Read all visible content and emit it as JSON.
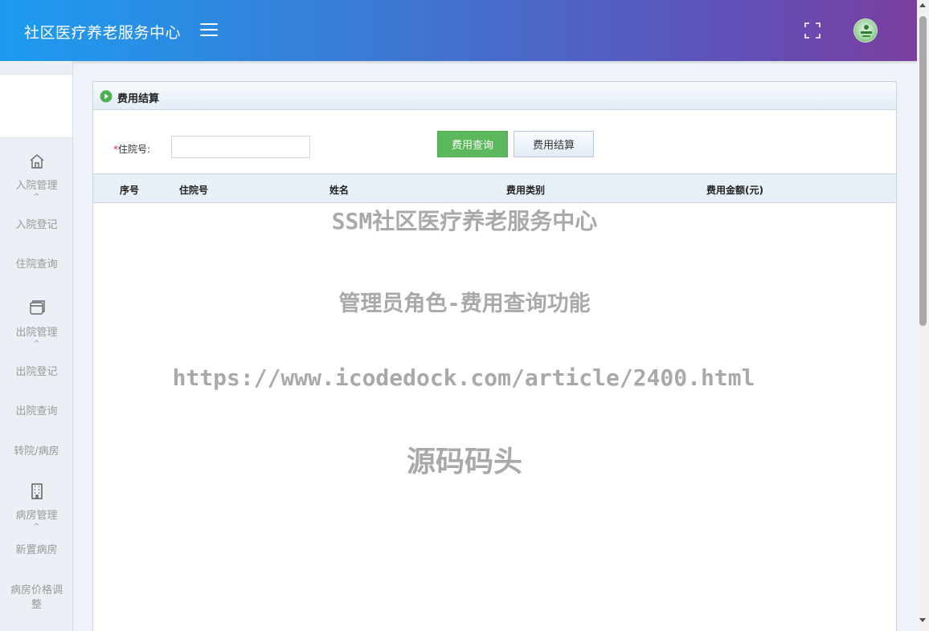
{
  "header": {
    "title": "社区医疗养老服务中心",
    "menu_icon": "hamburger-icon",
    "fullscreen_icon": "fullscreen-icon",
    "avatar_icon": "user-avatar"
  },
  "sidebar": {
    "groups": [
      {
        "label": "入院管理",
        "icon": "home-icon",
        "caret": "^",
        "items": [
          {
            "label": "入院登记"
          },
          {
            "label": "住院查询"
          }
        ]
      },
      {
        "label": "出院管理",
        "icon": "window-icon",
        "caret": "^",
        "items": [
          {
            "label": "出院登记"
          },
          {
            "label": "出院查询"
          },
          {
            "label": "转院/病房"
          }
        ]
      },
      {
        "label": "病房管理",
        "icon": "building-icon",
        "caret": "^",
        "items": [
          {
            "label": "新置病房"
          },
          {
            "label": "病房价格调整"
          }
        ]
      }
    ]
  },
  "panel": {
    "title": "费用结算",
    "form": {
      "required_mark": "*",
      "label": "住院号:",
      "input_value": "",
      "query_button": "费用查询",
      "settle_button": "费用结算"
    },
    "table": {
      "columns": [
        "序号",
        "住院号",
        "姓名",
        "费用类别",
        "费用金额(元)"
      ],
      "rows": []
    }
  },
  "watermark": {
    "line1": "SSM社区医疗养老服务中心",
    "line2": "管理员角色-费用查询功能",
    "line3": "https://www.icodedock.com/article/2400.html",
    "line4": "源码码头"
  },
  "colors": {
    "header_gradient_start": "#1d9bf0",
    "header_gradient_end": "#7b3fa0",
    "query_button": "#5cb85c"
  }
}
